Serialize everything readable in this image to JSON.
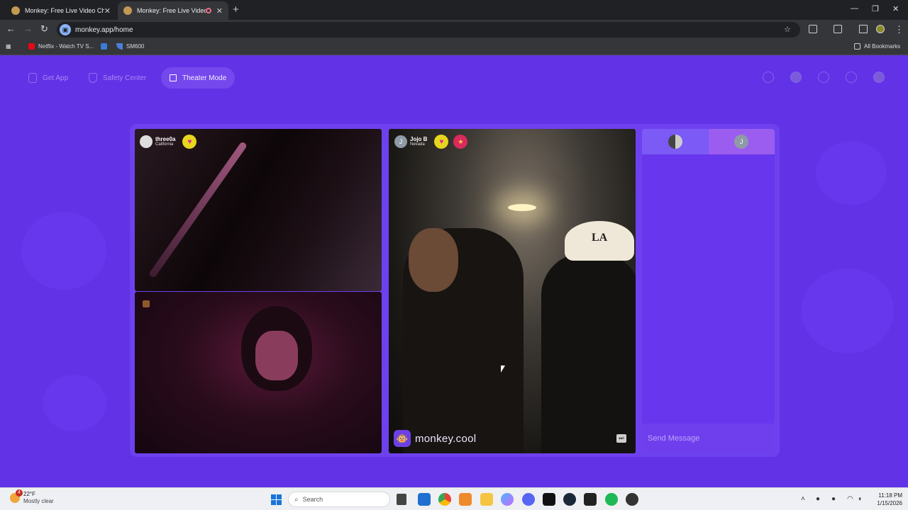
{
  "browser": {
    "tabs": [
      {
        "title": "Monkey: Free Live Video Chat",
        "active": false
      },
      {
        "title": "Monkey: Free Live Video Ch",
        "active": true
      }
    ],
    "new_tab": "+",
    "url": "monkey.app/home",
    "bookmarks": [
      {
        "label": "Netflix - Watch TV S...",
        "icon": "netflix-icon",
        "color": "#e50914"
      },
      {
        "label": "",
        "icon": "roblox-icon",
        "color": "#3a7bd5"
      },
      {
        "label": "SM600",
        "icon": "sm600-icon",
        "color": "#4a7fd8"
      }
    ],
    "all_bookmarks": "All Bookmarks"
  },
  "app": {
    "nav": {
      "get_app": "Get App",
      "safety_center": "Safety Center",
      "theater_mode": "Theater Mode"
    },
    "left_top_user": {
      "name": "three0a",
      "location": "California"
    },
    "right_user": {
      "initial": "J",
      "name": "Jojo B",
      "location": "Nevada"
    },
    "watermark": "monkey.cool",
    "chat": {
      "tab_b_initial": "J",
      "send_placeholder": "Send Message"
    },
    "colors": {
      "background": "#6232e6",
      "accent": "#7548ee",
      "heart_badge": "#e6d61e"
    }
  },
  "taskbar": {
    "weather": {
      "alert_count": "4",
      "temp": "22°F",
      "condition": "Mostly clear"
    },
    "search_placeholder": "Search",
    "time": "11:18 PM",
    "date": "1/15/2026"
  }
}
